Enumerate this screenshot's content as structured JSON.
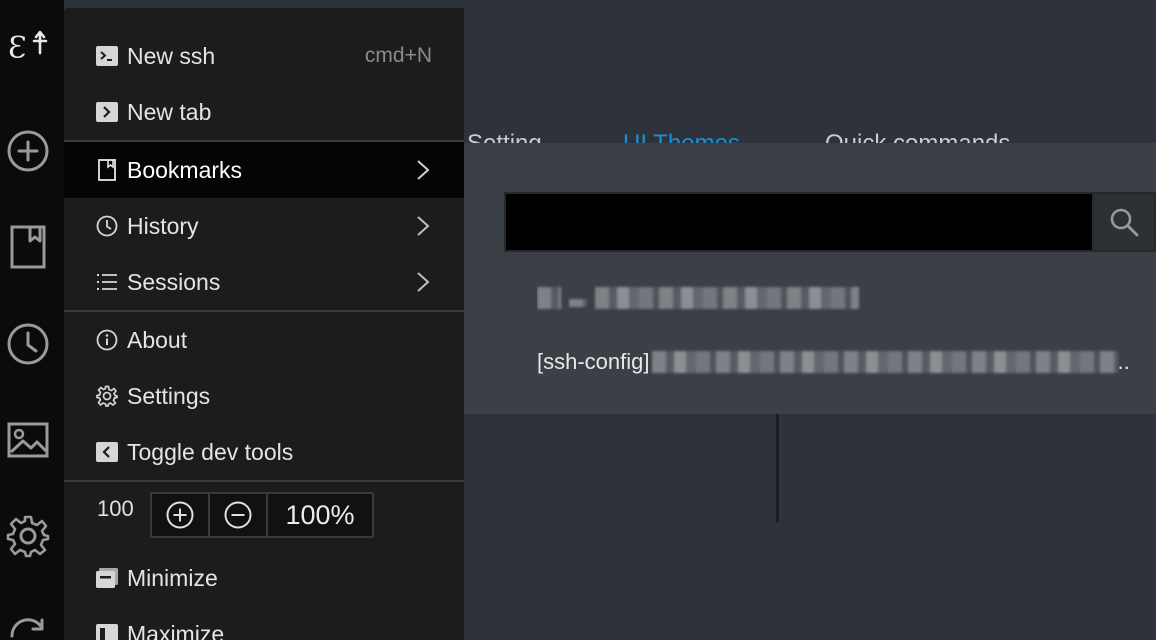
{
  "menu": {
    "new_ssh": {
      "label": "New ssh",
      "shortcut": "cmd+N",
      "icon": "terminal-icon"
    },
    "new_tab": {
      "label": "New tab",
      "icon": "tab-arrow-icon"
    },
    "bookmarks": {
      "label": "Bookmarks",
      "icon": "bookmark-icon",
      "active": true
    },
    "history": {
      "label": "History",
      "icon": "clock-icon"
    },
    "sessions": {
      "label": "Sessions",
      "icon": "list-icon"
    },
    "about": {
      "label": "About",
      "icon": "info-icon"
    },
    "settings": {
      "label": "Settings",
      "icon": "gear-icon"
    },
    "devtools": {
      "label": "Toggle dev tools",
      "icon": "chevron-left-box-icon"
    },
    "zoom": {
      "label": "100",
      "value": "100%"
    },
    "minimize": {
      "label": "Minimize",
      "icon": "minimize-window-icon"
    },
    "maximize": {
      "label": "Maximize",
      "icon": "maximize-window-icon"
    }
  },
  "background": {
    "tabs": [
      "Setting",
      "UI Themes",
      "Quick commands"
    ],
    "active_tab": "UI Themes",
    "search": {
      "value": "",
      "placeholder": ""
    },
    "results": [
      {
        "prefix": ""
      },
      {
        "prefix": "[ssh-config]",
        "suffix": ".."
      }
    ]
  },
  "rail": [
    "logo-icon",
    "add-icon",
    "bookmark-icon",
    "clock-icon",
    "image-icon",
    "gear-icon",
    "sync-icon"
  ],
  "colors": {
    "accent": "#1a8fd6",
    "menu_bg": "#1c1c1d",
    "panel_bg": "#3b3f46",
    "page_bg": "#2e323a"
  }
}
